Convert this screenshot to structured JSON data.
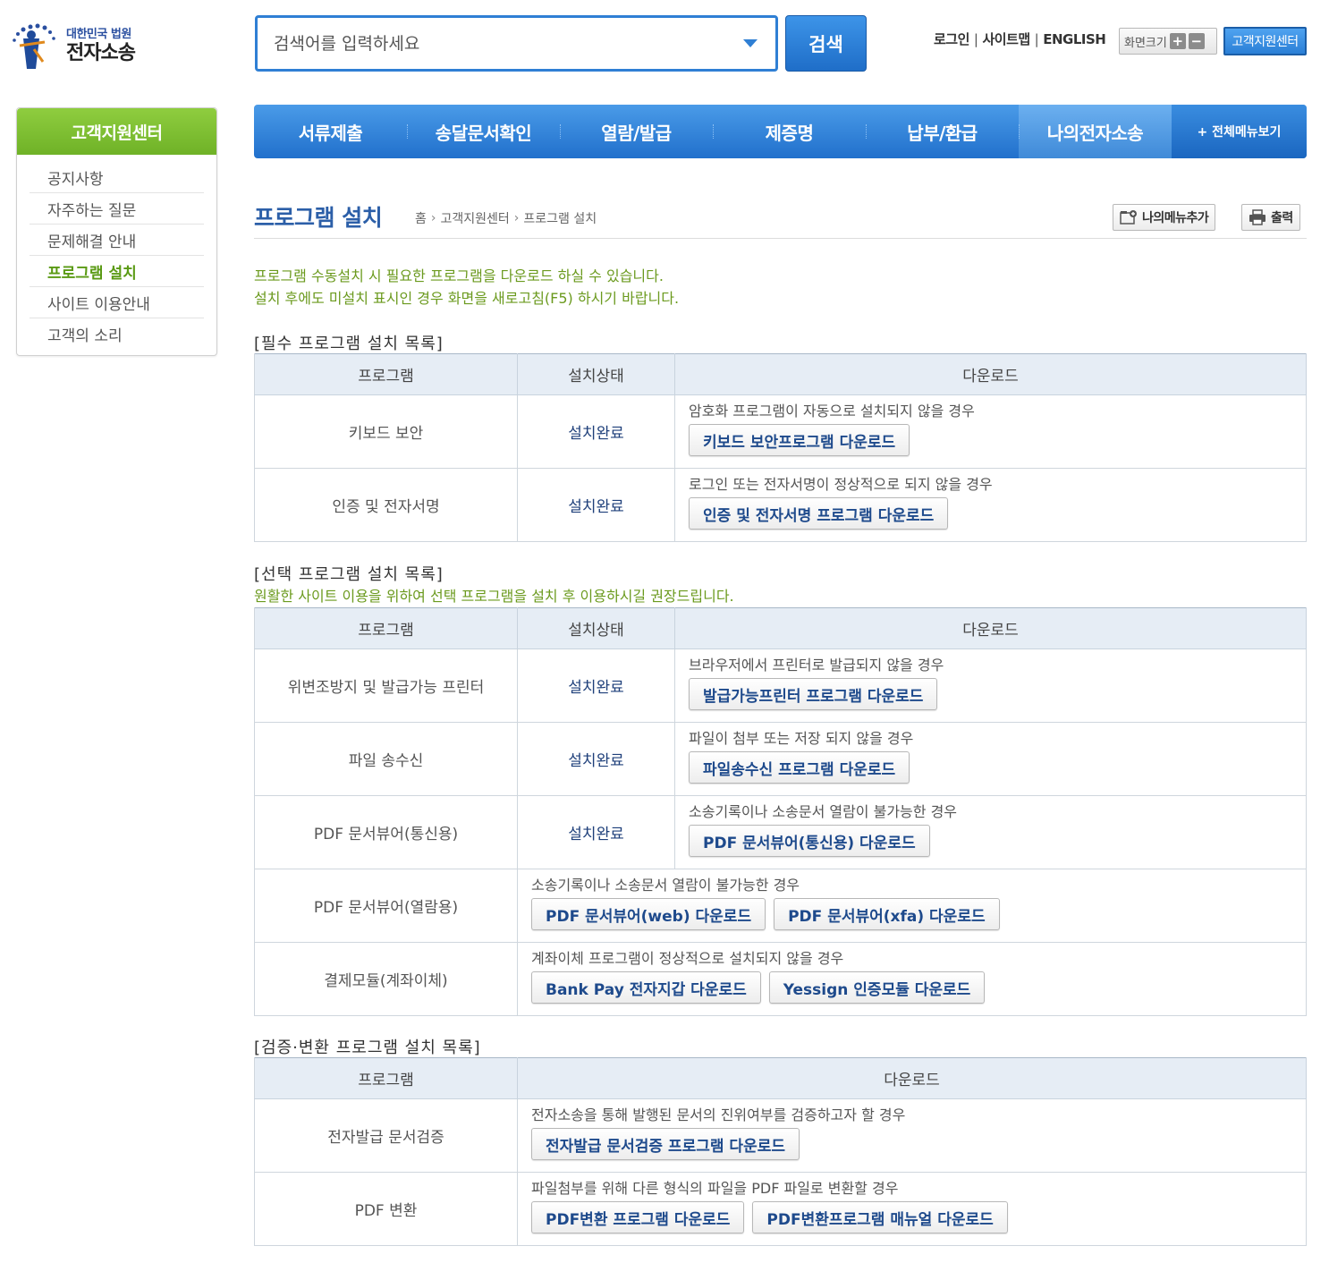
{
  "header": {
    "logo_sub": "대한민국 법원",
    "logo_main": "전자소송",
    "search_placeholder": "검색어를 입력하세요",
    "search_button": "검색",
    "links": [
      "로그인",
      "사이트맵",
      "ENGLISH"
    ],
    "zoom_label": "화면크기",
    "zoom_in": "+",
    "zoom_out": "−",
    "support_button": "고객지원센터"
  },
  "sidebar": {
    "title": "고객지원센터",
    "items": [
      "공지사항",
      "자주하는 질문",
      "문제해결 안내",
      "프로그램 설치",
      "사이트 이용안내",
      "고객의 소리"
    ],
    "active_index": 3
  },
  "nav": {
    "items": [
      "서류제출",
      "송달문서확인",
      "열람/발급",
      "제증명",
      "납부/환급",
      "나의전자소송"
    ],
    "active_index": 5,
    "all_menu": "+ 전체메뉴보기"
  },
  "page": {
    "title": "프로그램 설치",
    "breadcrumb": [
      "홈",
      "고객지원센터",
      "프로그램 설치"
    ],
    "add_menu_button": "나의메뉴추가",
    "print_button": "출력",
    "intro_lines": [
      "프로그램 수동설치 시 필요한 프로그램을 다운로드 하실 수 있습니다.",
      "설치 후에도 미설치 표시인 경우 화면을 새로고침(F5) 하시기 바랍니다."
    ]
  },
  "required": {
    "title": "[필수 프로그램 설치 목록]",
    "headers": [
      "프로그램",
      "설치상태",
      "다운로드"
    ],
    "rows": [
      {
        "name": "키보드 보안",
        "status": "설치완료",
        "desc": "암호화 프로그램이 자동으로 설치되지 않을 경우",
        "buttons": [
          "키보드 보안프로그램 다운로드"
        ]
      },
      {
        "name": "인증 및 전자서명",
        "status": "설치완료",
        "desc": "로그인 또는 전자서명이 정상적으로 되지 않을 경우",
        "buttons": [
          "인증 및 전자서명 프로그램 다운로드"
        ]
      }
    ]
  },
  "optional": {
    "title": "[선택 프로그램 설치 목록]",
    "note": "원활한 사이트 이용을 위하여 선택 프로그램을 설치 후 이용하시길 권장드립니다.",
    "headers": [
      "프로그램",
      "설치상태",
      "다운로드"
    ],
    "rows": [
      {
        "name": "위변조방지 및 발급가능 프린터",
        "status": "설치완료",
        "desc": "브라우저에서 프린터로 발급되지 않을 경우",
        "buttons": [
          "발급가능프린터 프로그램 다운로드"
        ]
      },
      {
        "name": "파일 송수신",
        "status": "설치완료",
        "desc": "파일이 첨부 또는 저장 되지 않을 경우",
        "buttons": [
          "파일송수신 프로그램 다운로드"
        ]
      },
      {
        "name": "PDF 문서뷰어(통신용)",
        "status": "설치완료",
        "desc": "소송기록이나 소송문서 열람이 불가능한 경우",
        "buttons": [
          "PDF 문서뷰어(통신용) 다운로드"
        ]
      },
      {
        "name": "PDF 문서뷰어(열람용)",
        "status": "",
        "desc": "소송기록이나 소송문서 열람이 불가능한 경우",
        "buttons": [
          "PDF 문서뷰어(web) 다운로드",
          "PDF 문서뷰어(xfa) 다운로드"
        ]
      },
      {
        "name": "결제모듈(계좌이체)",
        "status": "",
        "desc": "계좌이체 프로그램이 정상적으로 설치되지 않을 경우",
        "buttons": [
          "Bank Pay 전자지갑 다운로드",
          "Yessign 인증모듈 다운로드"
        ]
      }
    ]
  },
  "verify": {
    "title": "[검증·변환 프로그램 설치 목록]",
    "headers": [
      "프로그램",
      "다운로드"
    ],
    "rows": [
      {
        "name": "전자발급 문서검증",
        "desc": "전자소송을 통해 발행된 문서의 진위여부를 검증하고자 할 경우",
        "buttons": [
          "전자발급 문서검증 프로그램 다운로드"
        ]
      },
      {
        "name": "PDF 변환",
        "desc": "파일첨부를 위해 다른 형식의 파일을 PDF 파일로 변환할 경우",
        "buttons": [
          "PDF변환 프로그램 다운로드",
          "PDF변환프로그램 매뉴얼 다운로드"
        ]
      }
    ]
  },
  "colors": {
    "accent_blue": "#2170cc",
    "sidebar_green": "#6fb227",
    "note_green": "#6b9a1e",
    "title_blue": "#2c5fa8"
  }
}
